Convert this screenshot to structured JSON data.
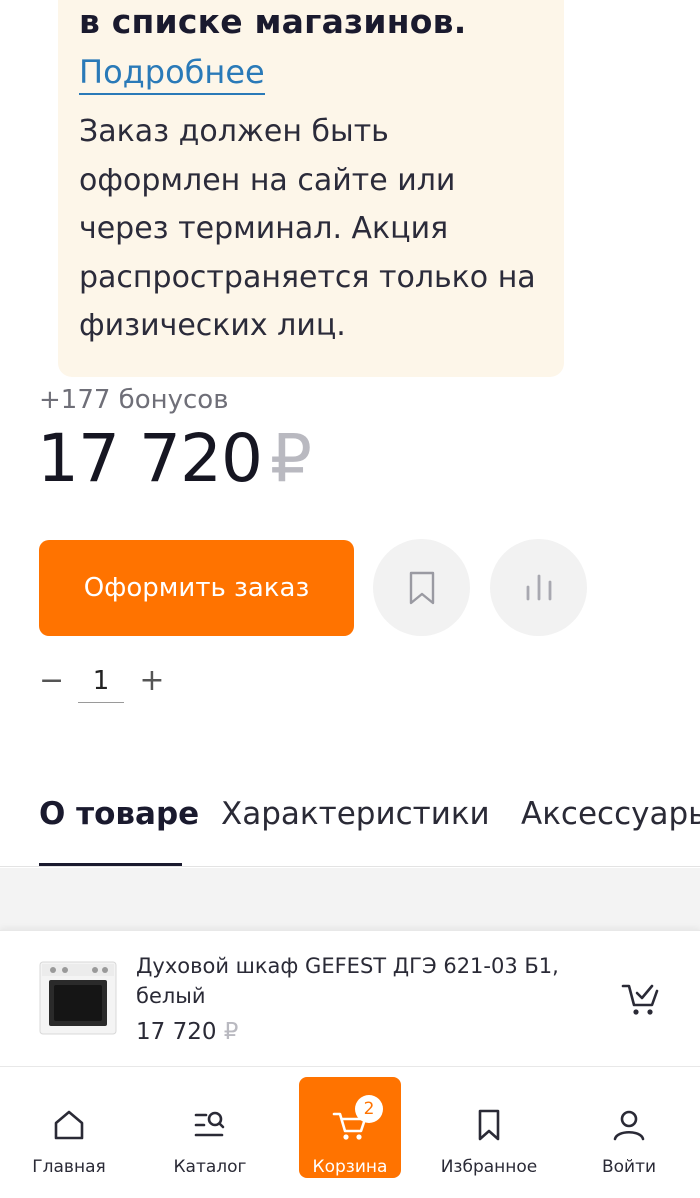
{
  "promo": {
    "headline": "в списке магазинов.",
    "link": "Подробнее",
    "text": "Заказ должен быть оформлен на сайте или через терминал. Акция распространяется только на физических лиц."
  },
  "product": {
    "bonus": "+177 бонусов",
    "price": "17 720",
    "currency": "₽",
    "order_button": "Оформить заказ",
    "quantity": "1",
    "qty_minus": "−",
    "qty_plus": "+"
  },
  "tabs": [
    {
      "label": "О товаре"
    },
    {
      "label": "Характеристики"
    },
    {
      "label": "Аксессуары"
    }
  ],
  "sticky": {
    "title": "Духовой шкаф GEFEST ДГЭ 621-03 Б1, белый",
    "price": "17 720",
    "currency": "₽"
  },
  "nav": [
    {
      "label": "Главная",
      "icon": "home-icon"
    },
    {
      "label": "Каталог",
      "icon": "catalog-icon"
    },
    {
      "label": "Корзина",
      "icon": "cart-icon",
      "badge": "2"
    },
    {
      "label": "Избранное",
      "icon": "bookmark-icon"
    },
    {
      "label": "Войти",
      "icon": "user-icon"
    }
  ],
  "colors": {
    "accent": "#ff7300",
    "link": "#2a7ab8",
    "promo_bg": "#fdf6e9"
  }
}
